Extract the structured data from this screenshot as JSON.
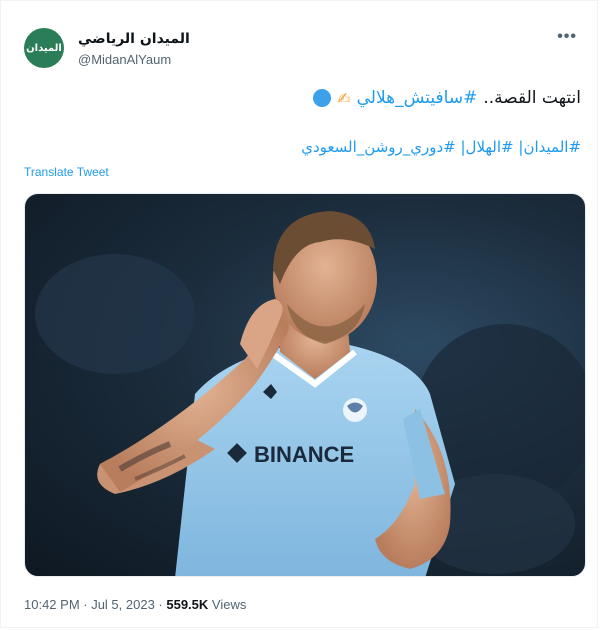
{
  "account": {
    "display_name": "الميدان الرياضي",
    "handle": "@MidanAlYaum",
    "avatar_text": "الميدان",
    "avatar_color": "#2a7d57"
  },
  "menu": {
    "more_icon": "•••"
  },
  "tweet": {
    "text_prefix": "انتهت القصة..",
    "hashtag_inline": "#سافيتش_هلالي",
    "emoji_pencil": "✍",
    "hashtags_line": "#الميدان| #الهلال| #دوري_روشن_السعودي",
    "translate_label": "Translate Tweet"
  },
  "media": {
    "jersey_sponsor": "BINANCE"
  },
  "meta": {
    "timestamp": "10:42 PM · Jul 5, 2023 · ",
    "views_count": "559.5K",
    "views_label": " Views"
  },
  "colors": {
    "link": "#1d9bf0",
    "secondary": "#536471"
  }
}
